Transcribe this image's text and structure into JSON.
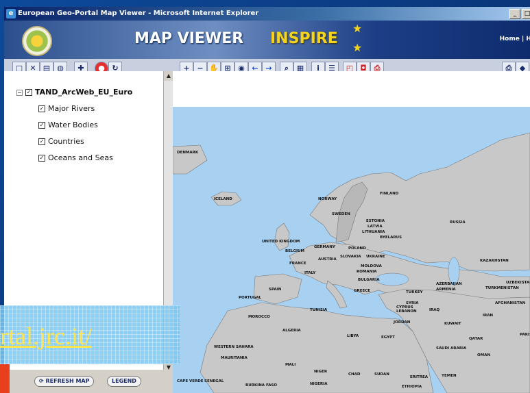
{
  "window": {
    "title": "European Geo-Portal Map Viewer - Microsoft Internet Explorer",
    "controls": [
      "_",
      "□"
    ]
  },
  "banner": {
    "title": "MAP VIEWER",
    "brand": "INSPIRE",
    "nav": "Home | He"
  },
  "toolbar": {
    "left_icons": [
      "new-icon",
      "delete-icon",
      "layers-icon",
      "refresh-layer-icon",
      "add-icon",
      "stop-icon",
      "reload-icon"
    ],
    "map_icons": [
      "zoom-in-icon",
      "zoom-out-icon",
      "pan-icon",
      "zoom-box-icon",
      "globe-icon",
      "back-icon",
      "forward-icon",
      "find-icon",
      "measure-icon",
      "info-icon",
      "legend-list-icon",
      "select-icon",
      "bookmark-icon",
      "print-icon",
      "print2-icon"
    ]
  },
  "layers": {
    "root": "TAND_ArcWeb_EU_Euro",
    "items": [
      "Major Rivers",
      "Water Bodies",
      "Countries",
      "Oceans and Seas"
    ]
  },
  "buttons": {
    "refresh": "REFRESH MAP",
    "legend": "LEGEND"
  },
  "overlay": {
    "url": "rtal.jrc.it/"
  },
  "map": {
    "countries": [
      "DENMARK",
      "ICELAND",
      "NORWAY",
      "SWEDEN",
      "FINLAND",
      "ESTONIA",
      "LATVIA",
      "LITHUANIA",
      "BYELARUS",
      "RUSSIA",
      "UNITED KINGDOM",
      "BELGIUM",
      "GERMANY",
      "POLAND",
      "SLOVAKIA",
      "UKRAINE",
      "FRANCE",
      "AUSTRIA",
      "MOLDOVA",
      "ROMANIA",
      "ITALY",
      "BULGARIA",
      "SPAIN",
      "PORTUGAL",
      "GREECE",
      "TURKEY",
      "AZERBAIJAN",
      "ARMENIA",
      "KAZAKHSTAN",
      "UZBEKISTAN",
      "TURKMENISTAN",
      "TUNISIA",
      "MOROCCO",
      "ALGERIA",
      "LIBYA",
      "EGYPT",
      "CYPRUS",
      "SYRIA",
      "LEBANON",
      "IRAQ",
      "JORDAN",
      "IRAN",
      "AFGHANISTAN",
      "KUWAIT",
      "QATAR",
      "PAKIST",
      "SAUDI ARABIA",
      "OMAN",
      "WESTERN SAHARA",
      "MAURITANIA",
      "MALI",
      "NIGER",
      "CHAD",
      "SUDAN",
      "ERITREA",
      "YEMEN",
      "CAPE VERDE",
      "SENEGAL",
      "BURKINA FASO",
      "NIGERIA",
      "ETHIOPIA"
    ],
    "colors": {
      "sea": "#a8d0f0",
      "land": "#c8c8c8",
      "top_band": "#ffffff"
    }
  }
}
